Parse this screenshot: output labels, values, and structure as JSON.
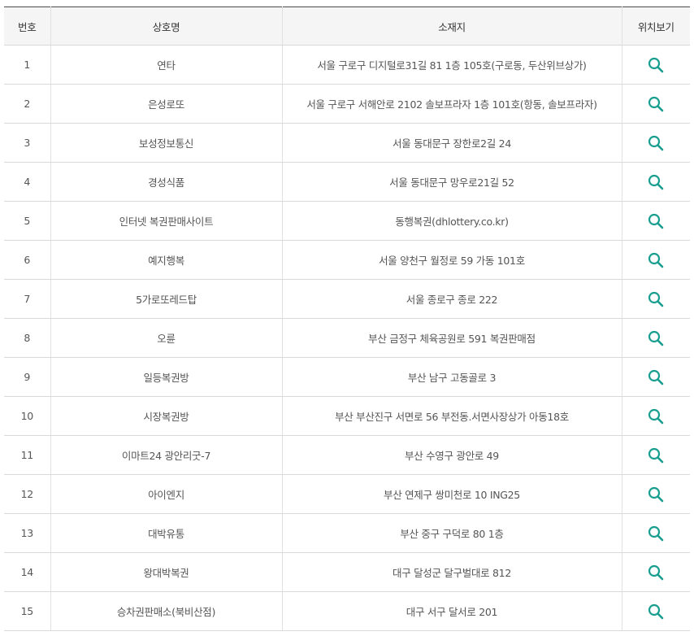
{
  "table": {
    "headers": {
      "no": "번호",
      "name": "상호명",
      "address": "소재지",
      "map": "위치보기"
    },
    "rows": [
      {
        "no": "1",
        "name": "연타",
        "address": "서울 구로구 디지털로31길 81 1층 105호(구로동, 두산위브상가)"
      },
      {
        "no": "2",
        "name": "은성로또",
        "address": "서울 구로구 서해안로 2102 솔보프라자 1층 101호(항동, 솔보프라자)"
      },
      {
        "no": "3",
        "name": "보성정보통신",
        "address": "서울 동대문구 장한로2길 24"
      },
      {
        "no": "4",
        "name": "경성식품",
        "address": "서울 동대문구 망우로21길 52"
      },
      {
        "no": "5",
        "name": "인터넷 복권판매사이트",
        "address": "동행복권(dhlottery.co.kr)"
      },
      {
        "no": "6",
        "name": "예지행복",
        "address": "서울 양천구 월정로 59 가동 101호"
      },
      {
        "no": "7",
        "name": "5가로또레드탑",
        "address": "서울 종로구 종로 222"
      },
      {
        "no": "8",
        "name": "오륜",
        "address": "부산 금정구 체육공원로 591 복권판매점"
      },
      {
        "no": "9",
        "name": "일등복권방",
        "address": "부산 남구 고동골로 3"
      },
      {
        "no": "10",
        "name": "시장복권방",
        "address": "부산 부산진구 서면로 56 부전동.서면사장상가 아동18호"
      },
      {
        "no": "11",
        "name": "이마트24 광안리굿-7",
        "address": "부산 수영구 광안로 49"
      },
      {
        "no": "12",
        "name": "아이엔지",
        "address": "부산 연제구 쌍미천로 10 ING25"
      },
      {
        "no": "13",
        "name": "대박유통",
        "address": "부산 중구 구덕로 80 1층"
      },
      {
        "no": "14",
        "name": "왕대박복권",
        "address": "대구 달성군 달구벌대로 812"
      },
      {
        "no": "15",
        "name": "승차권판매소(북비산점)",
        "address": "대구 서구 달서로 201"
      }
    ]
  },
  "icons": {
    "map_icon": "search-icon"
  },
  "colors": {
    "icon_accent": "#1a9e8f",
    "header_bg": "#f5f5f5",
    "top_border": "#4a4a4a"
  }
}
